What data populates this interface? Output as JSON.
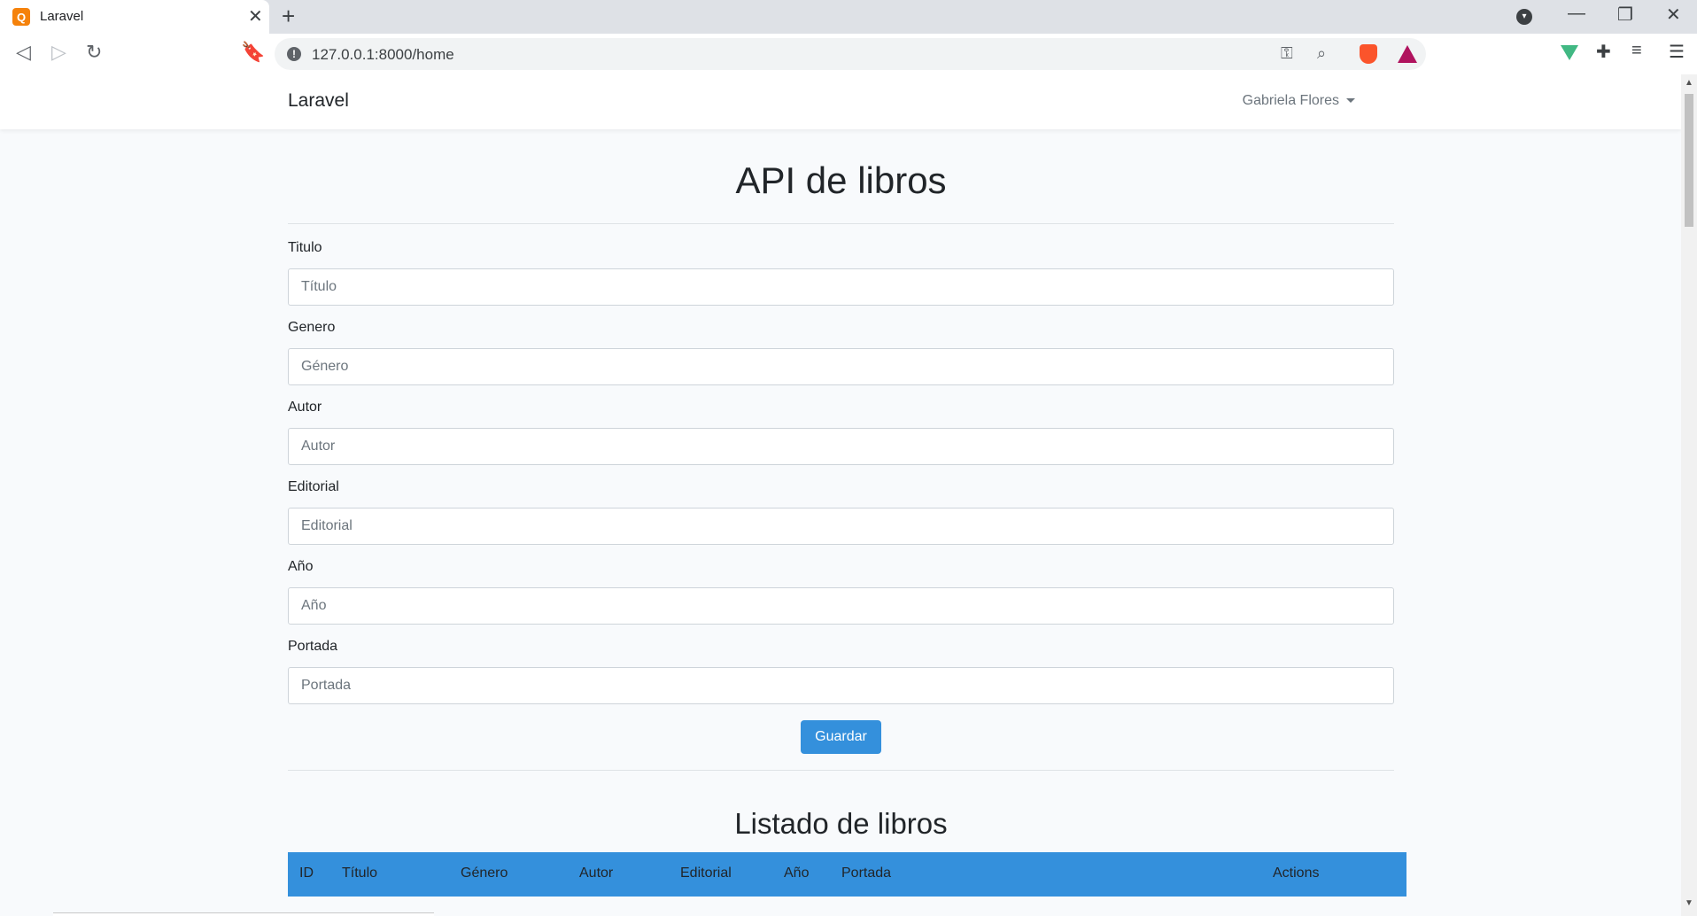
{
  "browser": {
    "tab_title": "Laravel",
    "favicon_letter": "Q",
    "url": "127.0.0.1:8000/home",
    "new_tab_label": "+",
    "close_tab_label": "✕"
  },
  "navbar": {
    "brand": "Laravel",
    "user_name": "Gabriela Flores"
  },
  "page": {
    "title": "API de libros"
  },
  "form": {
    "fields": [
      {
        "label": "Titulo",
        "placeholder": "Título",
        "value": ""
      },
      {
        "label": "Genero",
        "placeholder": "Género",
        "value": ""
      },
      {
        "label": "Autor",
        "placeholder": "Autor",
        "value": ""
      },
      {
        "label": "Editorial",
        "placeholder": "Editorial",
        "value": ""
      },
      {
        "label": "Año",
        "placeholder": "Año",
        "value": ""
      },
      {
        "label": "Portada",
        "placeholder": "Portada",
        "value": ""
      }
    ],
    "submit_label": "Guardar"
  },
  "list": {
    "title": "Listado de libros",
    "columns": [
      "ID",
      "Título",
      "Género",
      "Autor",
      "Editorial",
      "Año",
      "Portada",
      "Actions"
    ]
  },
  "colors": {
    "primary": "#3490dc",
    "page_bg": "#f8fafc",
    "tab_bar_bg": "#dee1e6"
  }
}
